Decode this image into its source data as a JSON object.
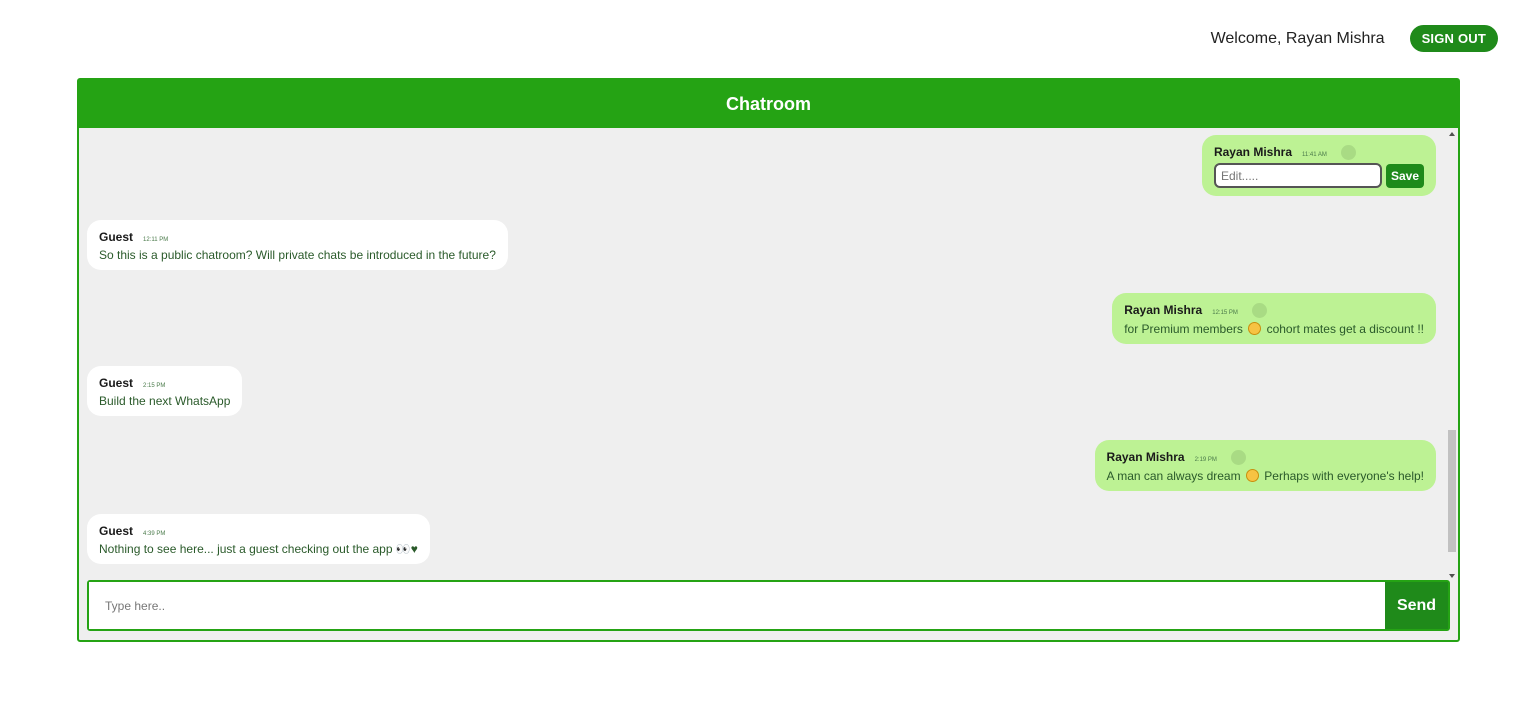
{
  "header": {
    "welcome": "Welcome, Rayan Mishra",
    "sign_out": "SIGN OUT"
  },
  "chatroom": {
    "title": "Chatroom",
    "messages": [
      {
        "author": "Rayan Mishra",
        "time": "11:41 AM",
        "editing": true,
        "edit_placeholder": "Edit.....",
        "save_label": "Save"
      },
      {
        "author": "Guest",
        "time": "12:11 PM",
        "text": "So this is a public chatroom? Will private chats be introduced in the future?"
      },
      {
        "author": "Rayan Mishra",
        "time": "12:15 PM",
        "text_before": "for Premium members",
        "emoji": "grinning-face-emoji",
        "text_after": "cohort mates get a discount !!"
      },
      {
        "author": "Guest",
        "time": "2:15 PM",
        "text": "Build the next WhatsApp"
      },
      {
        "author": "Rayan Mishra",
        "time": "2:19 PM",
        "text_before": "A man can always dream",
        "emoji": "smiling-face-emoji",
        "text_after": "Perhaps with everyone's help!"
      },
      {
        "author": "Guest",
        "time": "4:39 PM",
        "text": "Nothing to see here... just a guest checking out the app 👀♥"
      }
    ],
    "composer": {
      "placeholder": "Type here..",
      "send_label": "Send"
    }
  },
  "colors": {
    "brand": "#25a314",
    "button": "#1f8a1a",
    "own_bubble": "#bdf294",
    "guest_bubble": "#ffffff",
    "chat_background": "#efefef"
  }
}
